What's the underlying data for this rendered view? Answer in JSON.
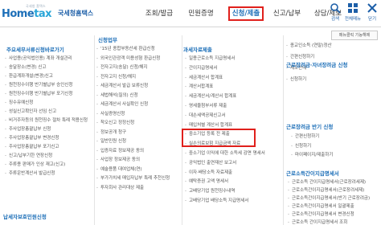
{
  "logo": {
    "sub": "국세청 홈택스",
    "main_h": "Home",
    "main_t": "tax",
    "name": "국세청홈택스"
  },
  "gnb": [
    "조회/발급",
    "민원증명",
    "신청/제출",
    "신고/납부",
    "상담/제보"
  ],
  "util": [
    {
      "label": "검색",
      "icon": "search-icon"
    },
    {
      "label": "전체메뉴",
      "icon": "menu-icon"
    },
    {
      "label": "닫기",
      "icon": "close-icon"
    }
  ],
  "reset_label": "메뉴클릭 기능해제",
  "col1": {
    "head": "주요세무서류신청바로가기",
    "items": [
      "사업용(공익법인용) 계좌 개설관리",
      "송달장소(변경) 신고",
      "환급계좌개설(변경)신고",
      "원천징수이행 반기별납부 승인신청",
      "원천징수이행 반기별납부 포기신청",
      "징수유예신청",
      "성실신고확인자 선임 신고",
      "비거주자등의 원천징수 절차 특례 적용신청",
      "주사업장총괄납부 신청",
      "주사업장총괄납부 변경신청",
      "주사업장총괄납부 포기신고",
      "신고/납부기한 연장신청",
      "주류용 판매가 인상 재고(신고)",
      "주류운반계산서 발급신청"
    ],
    "foot": "납세자보호민원신청"
  },
  "col2": {
    "head": "신청업무",
    "items": [
      "'15년 종합부동산세 환급신청",
      "외국인관광객 미용성형 환급신청",
      "전자고지(송달) 신청/해지",
      "전자고지 신청/해지",
      "세금계산서 발급 보류신청",
      "세법해석(질의) 신청",
      "세금계산서 사실확인 신청",
      "사실증명신청",
      "착오신고 정정신청",
      "정보공개 청구",
      "일반민원 신청",
      "입증자료 정보제공 동의",
      "사업장 정보제공 동의",
      "예술용품 대여업체(연)",
      "부가가치세 매입자납부 특례 추천신청",
      "투자회사 관리대상 제출"
    ]
  },
  "col3": {
    "head": "과세자료제출",
    "items": [
      "일용근로소득 지급명세서",
      "간이지급명세서",
      "세금계산서 합계표",
      "계산서합계표",
      "세금계산서/계산서 합계표",
      "영세율첨부서류 제출",
      "대손세액공제신고서",
      "매입처별 계산서 합계표",
      "중소기업 등록 전 제출",
      "실손의료보험 지급금액 자료",
      "중소기업 이익에 대한 소득세 감면 명세서",
      "공익법인 출연재산 보고서",
      "이자·배당소득 자료제출",
      "예탁증권 고액 명세서",
      "고배당기업 원천징수내역",
      "고배당기업 배당소득 지급명세서"
    ],
    "highlight": [
      "중소기업 이익에 대한 소득세 감면 명세서"
    ]
  },
  "col4": {
    "head": "근로장려금·자녀장려금 신청",
    "items": [
      "종교인소득 (연말)정산",
      "간편신청하기",
      "제도안내",
      "신청하기"
    ],
    "head2": "근로장려금 반기 신청",
    "items2": [
      "간편신청하기",
      "신청하기",
      "마이페이지/제출하기"
    ],
    "head3": "근로소득간이지급명세서",
    "items3": [
      "근로소득 간이지급명세서(근로장려세제)",
      "근로소득간이지급명세서(근로장려세제)",
      "근로소득간이지급명세서(반기 근로장려금)",
      "근로소득간이지급명세서 일괄제출",
      "근로소득간이지급명세서 변경신청",
      "근로소득 간이지급명세서 조회"
    ]
  }
}
